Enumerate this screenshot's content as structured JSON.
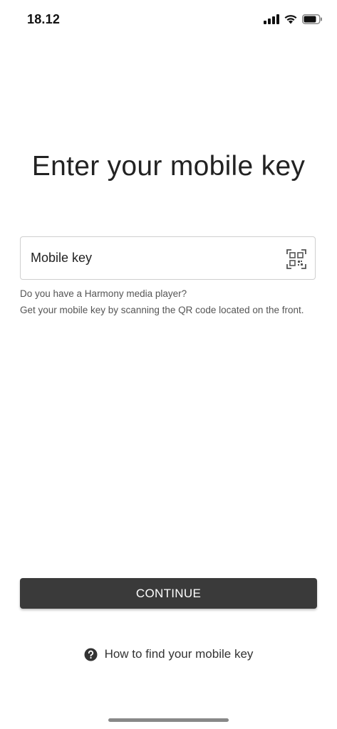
{
  "status_bar": {
    "time": "18.12",
    "icons": [
      "cellular-signal-icon",
      "wifi-icon",
      "battery-icon"
    ]
  },
  "title": "Enter your mobile key",
  "mobile_key_field": {
    "placeholder": "Mobile key",
    "value": "",
    "action_icon": "qr-code-scan-icon"
  },
  "helper": {
    "line1": "Do you have a Harmony media player?",
    "line2": "Get your mobile key by scanning the QR code located on the front."
  },
  "continue_button": {
    "label": "CONTINUE",
    "color": "#3a3a3a"
  },
  "help_link": {
    "icon": "question-circle-icon",
    "label": "How to find your mobile key"
  }
}
